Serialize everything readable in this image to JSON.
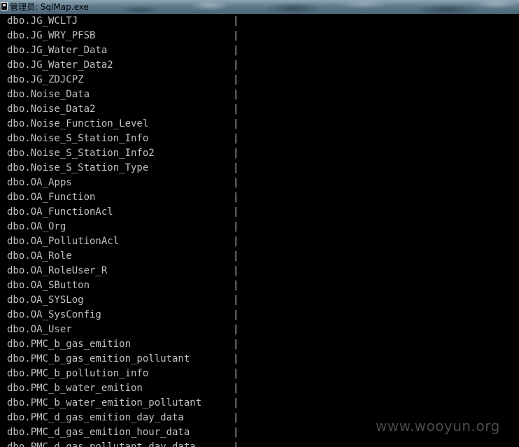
{
  "window": {
    "title": "管理员: SqlMap.exe"
  },
  "console": {
    "separator": "|",
    "lines": [
      "dbo.JG_WCLTJ",
      "dbo.JG_WRY_PFSB",
      "dbo.JG_Water_Data",
      "dbo.JG_Water_Data2",
      "dbo.JG_ZDJCPZ",
      "dbo.Noise_Data",
      "dbo.Noise_Data2",
      "dbo.Noise_Function_Level",
      "dbo.Noise_S_Station_Info",
      "dbo.Noise_S_Station_Info2",
      "dbo.Noise_S_Station_Type",
      "dbo.OA_Apps",
      "dbo.OA_Function",
      "dbo.OA_FunctionAcl",
      "dbo.OA_Org",
      "dbo.OA_PollutionAcl",
      "dbo.OA_Role",
      "dbo.OA_RoleUser_R",
      "dbo.OA_SButton",
      "dbo.OA_SYSLog",
      "dbo.OA_SysConfig",
      "dbo.OA_User",
      "dbo.PMC_b_gas_emition",
      "dbo.PMC_b_gas_emition_pollutant",
      "dbo.PMC_b_pollution_info",
      "dbo.PMC_b_water_emition",
      "dbo.PMC_b_water_emition_pollutant",
      "dbo.PMC_d_gas_emition_day_data",
      "dbo.PMC_d_gas_emition_hour_data",
      "dbo.PMC_d_gas_pollutant_day_data"
    ]
  },
  "watermark": "www.wooyun.org"
}
